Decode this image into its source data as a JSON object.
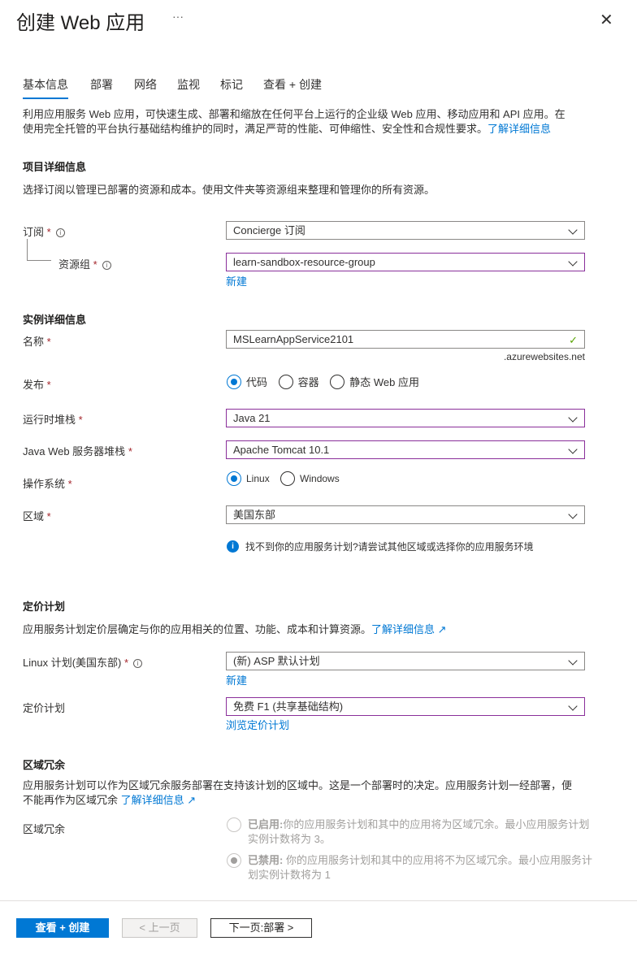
{
  "header": {
    "title": "创建 Web 应用",
    "more": "···",
    "close": "✕"
  },
  "tabs": [
    "基本信息",
    "部署",
    "网络",
    "监视",
    "标记",
    "查看 + 创建"
  ],
  "intro": {
    "text1": "利用应用服务 Web 应用，可快速生成、部署和缩放在任何平台上运行的企业级 Web 应用、移动应用和 API 应用。在",
    "text2": "使用完全托管的平台执行基础结构维护的同时，满足严苛的性能、可伸缩性、安全性和合规性要求。",
    "link": "了解详细信息"
  },
  "project": {
    "heading": "项目详细信息",
    "desc": "选择订阅以管理已部署的资源和成本。使用文件夹等资源组来整理和管理你的所有资源。",
    "subscription_label": "订阅",
    "subscription_value": "Concierge 订阅",
    "rg_label": "资源组",
    "rg_value": "learn-sandbox-resource-group",
    "new_link": "新建"
  },
  "instance": {
    "heading": "实例详细信息",
    "name_label": "名称",
    "name_value": "MSLearnAppService2101",
    "name_suffix": ".azurewebsites.net",
    "publish_label": "发布",
    "publish_options": [
      "代码",
      "容器",
      "静态 Web 应用"
    ],
    "runtime_label": "运行时堆栈",
    "runtime_value": "Java 21",
    "java_label": "Java Web 服务器堆栈",
    "java_value": "Apache Tomcat 10.1",
    "os_label": "操作系统",
    "os_options": [
      "Linux",
      "Windows"
    ],
    "region_label": "区域",
    "region_value": "美国东部",
    "region_info": "找不到你的应用服务计划?请尝试其他区域或选择你的应用服务环境"
  },
  "pricing": {
    "heading": "定价计划",
    "desc": "应用服务计划定价层确定与你的应用相关的位置、功能、成本和计算资源。",
    "link": "了解详细信息",
    "plan_label": "Linux 计划(美国东部)",
    "plan_value": "(新) ASP 默认计划",
    "new_link": "新建",
    "tier_label": "定价计划",
    "tier_value": "免费 F1 (共享基础结构)",
    "browse_link": "浏览定价计划"
  },
  "zone": {
    "heading": "区域冗余",
    "desc1": "应用服务计划可以作为区域冗余服务部署在支持该计划的区域中。这是一个部署时的决定。应用服务计划一经部署，便",
    "desc2": "不能再作为区域冗余",
    "link": "了解详细信息",
    "label": "区域冗余",
    "enabled_title": "已启用:",
    "enabled_text1": "你的应用服务计划和其中的应用将为区域冗余。最小应用服务计划",
    "enabled_text2": "实例计数将为 3。",
    "disabled_title": "已禁用:",
    "disabled_text1": " 你的应用服务计划和其中的应用将不为区域冗余。最小应用服务计",
    "disabled_text2": "划实例计数将为 1"
  },
  "footer": {
    "review": "查看 + 创建",
    "prev": "< 上一页",
    "next": "下一页:部署 >"
  },
  "colors": {
    "accent": "#0078d4",
    "focus_border": "#8a2f9a"
  }
}
